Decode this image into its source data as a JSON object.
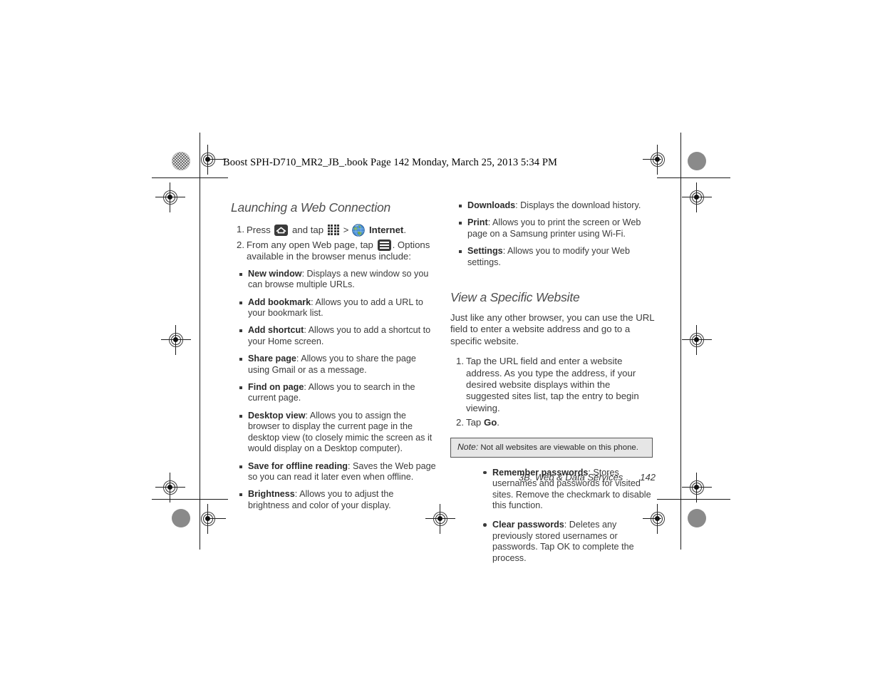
{
  "document": {
    "runhead": "Boost SPH-D710_MR2_JB_.book  Page 142  Monday, March 25, 2013  5:34 PM",
    "footer": {
      "chapter": "3B. Web & Data Services",
      "page_number": "142"
    }
  },
  "left_column": {
    "heading": "Launching a Web Connection",
    "steps": [
      {
        "num": "1.",
        "parts": [
          {
            "type": "text",
            "value": "Press "
          },
          {
            "type": "icon",
            "name": "home-icon"
          },
          {
            "type": "text",
            "value": " and tap "
          },
          {
            "type": "icon",
            "name": "apps-grid-icon"
          },
          {
            "type": "text",
            "value": ">"
          },
          {
            "type": "icon",
            "name": "globe-internet-icon"
          },
          {
            "type": "bold",
            "value": "Internet"
          },
          {
            "type": "text",
            "value": "."
          }
        ]
      },
      {
        "num": "2.",
        "parts": [
          {
            "type": "text",
            "value": "From any open Web page, tap "
          },
          {
            "type": "icon",
            "name": "menu-icon"
          },
          {
            "type": "text",
            "value": ". Options available in the browser menus include:"
          }
        ]
      }
    ],
    "options": [
      {
        "term": "New window",
        "desc": ": Displays a new window so you can browse multiple URLs."
      },
      {
        "term": "Add bookmark",
        "desc": ": Allows you to add a URL to your bookmark list."
      },
      {
        "term": "Add shortcut",
        "desc": ": Allows you to add a shortcut to your Home screen."
      },
      {
        "term": "Share page",
        "desc": ": Allows you to share the page using Gmail or as a message."
      },
      {
        "term": "Find on page",
        "desc": ": Allows you to search in the current page."
      },
      {
        "term": "Desktop view",
        "desc": ": Allows you to assign the browser to display the current page in the desktop view (to closely mimic the screen as it would display on a Desktop computer)."
      },
      {
        "term": "Save for offline reading",
        "desc": ": Saves the Web page so you can read it later even when offline."
      },
      {
        "term": "Brightness",
        "desc": ": Allows you to adjust the brightness and color of your display."
      }
    ]
  },
  "right_column": {
    "options_continued": [
      {
        "term": "Downloads",
        "desc": ": Displays the download history."
      },
      {
        "term": "Print",
        "desc": ": Allows you to print the screen or Web page on a Samsung printer using Wi-Fi."
      },
      {
        "term": "Settings",
        "desc": ": Allows you to modify your Web settings."
      }
    ],
    "heading": "View a Specific Website",
    "intro": "Just like any other browser, you can use the URL field to enter a website address and go to a specific website.",
    "steps": [
      {
        "num": "1.",
        "parts": [
          {
            "type": "text",
            "value": "Tap the URL field and enter a website address. As you type the address, if your desired website displays within the suggested sites list, tap the entry to begin viewing."
          }
        ]
      },
      {
        "num": "2.",
        "parts": [
          {
            "type": "text",
            "value": "Tap "
          },
          {
            "type": "bold",
            "value": "Go"
          },
          {
            "type": "text",
            "value": "."
          }
        ]
      }
    ],
    "note": {
      "label": "Note:",
      "text": "Not all websites are viewable on this phone."
    },
    "password_options": [
      {
        "term": "Remember passwords",
        "desc": ": Stores usernames and passwords for visited sites. Remove the checkmark to disable this function."
      },
      {
        "term": "Clear passwords",
        "desc": ": Deletes any previously stored usernames or passwords. Tap OK to complete the process."
      }
    ]
  },
  "colors": {
    "text": "#3b3b3b",
    "heading": "#4d4d4d",
    "note_bg": "#e6e6e6",
    "note_border": "#565656",
    "icon_dark": "#3a3a3a",
    "globe_blue": "#3f7fc1",
    "globe_green": "#6fa64a",
    "registration_gray": "#8a8a8a"
  }
}
